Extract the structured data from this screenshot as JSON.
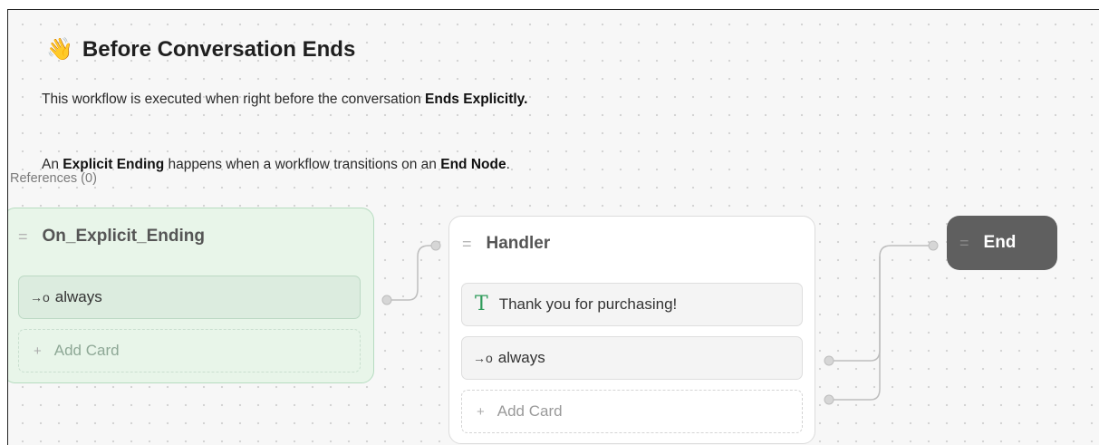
{
  "header": {
    "icon": "waving-hand-icon",
    "icon_glyph": "👋",
    "title": "Before Conversation Ends"
  },
  "description": {
    "line1_prefix": "This workflow is executed when right before the conversation ",
    "line1_bold": "Ends Explicitly.",
    "line2_a": "An ",
    "line2_bold1": "Explicit Ending",
    "line2_b": " happens when a workflow transitions on an ",
    "line2_bold2": "End Node",
    "line2_c": "."
  },
  "references_label": "References (0)",
  "nodes": {
    "start": {
      "title": "On_Explicit_Ending",
      "drag_glyph": "=",
      "cards": {
        "condition_arrow": "→o",
        "condition_label": "always",
        "add_glyph": "+",
        "add_label": "Add Card"
      }
    },
    "handler": {
      "title": "Handler",
      "drag_glyph": "=",
      "cards": {
        "text_glyph": "T",
        "text_label": "Thank you for purchasing!",
        "condition_arrow": "→o",
        "condition_label": "always",
        "add_glyph": "+",
        "add_label": "Add Card"
      }
    },
    "end": {
      "title": "End",
      "drag_glyph": "="
    }
  },
  "colors": {
    "start_node_bg": "#e8f5e9",
    "end_node_bg": "#5f5f5f",
    "text_card_icon": "#2e9b5a",
    "edge": "#bdbdbd"
  }
}
